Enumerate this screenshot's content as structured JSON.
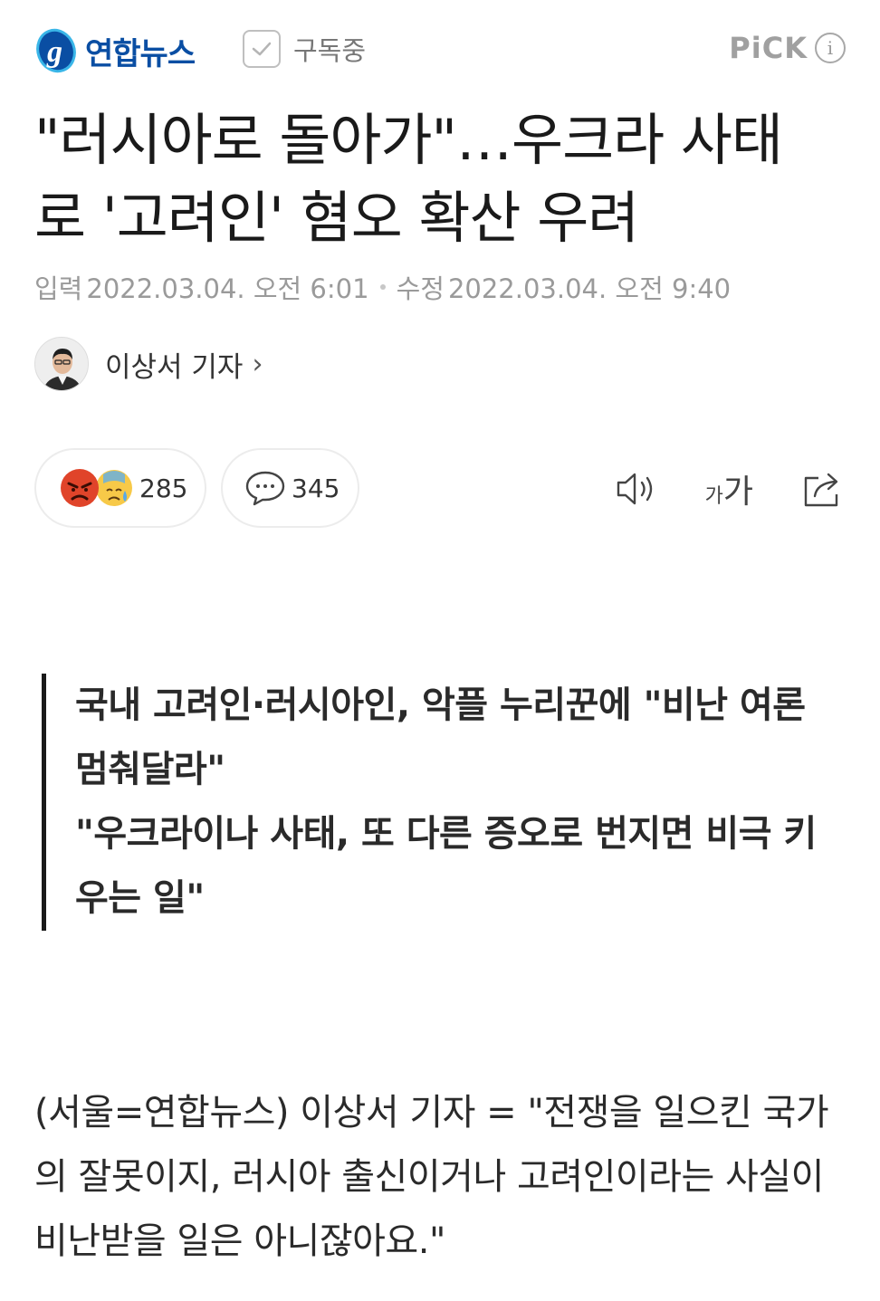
{
  "header": {
    "brand": "연합뉴스",
    "subscribe_label": "구독중",
    "pick_label": "PiCK",
    "pick_info": "i"
  },
  "article": {
    "title": "\"러시아로 돌아가\"…우크라 사태로 '고려인' 혐오 확산 우려",
    "published_label": "입력",
    "published": "2022.03.04. 오전 6:01",
    "modified_label": "수정",
    "modified": "2022.03.04. 오전 9:40",
    "reporter": "이상서 기자",
    "reporter_chevron": "›"
  },
  "reactions": {
    "count": "285",
    "comments": "345"
  },
  "toolbar": {
    "font_small": "가",
    "font_big": "가"
  },
  "summary": [
    "국내 고려인·러시아인, 악플 누리꾼에 \"비난 여론 멈춰달라\"",
    "\"우크라이나 사태, 또 다른 증오로 번지면 비극 키우는 일\""
  ],
  "body": "(서울=연합뉴스) 이상서 기자 = \"전쟁을 일으킨 국가의 잘못이지, 러시아 출신이거나 고려인이라는 사실이 비난받을 일은 아니잖아요.\"",
  "colors": {
    "brand_blue": "#0a4ea3",
    "angry_red": "#e0442a",
    "sad_yellow": "#f7c948"
  },
  "icons": [
    "yonhap-logo-icon",
    "checkbox-icon",
    "info-icon",
    "angry-face-icon",
    "sad-face-icon",
    "comment-bubble-icon",
    "speaker-icon",
    "share-icon"
  ]
}
